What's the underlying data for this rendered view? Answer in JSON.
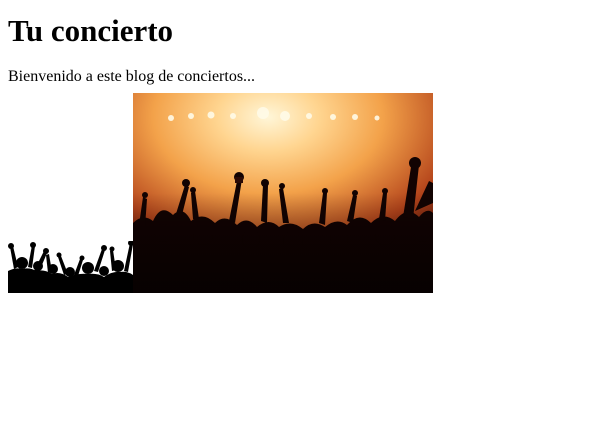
{
  "page": {
    "title": "Tu concierto",
    "intro": "Bienvenido a este blog de conciertos..."
  },
  "images": {
    "silhouette": {
      "kind": "crowd-silhouette-clipart"
    },
    "photo": {
      "kind": "concert-crowd-photo",
      "accent": "#f3a24a",
      "dark": "#0a0302"
    }
  }
}
